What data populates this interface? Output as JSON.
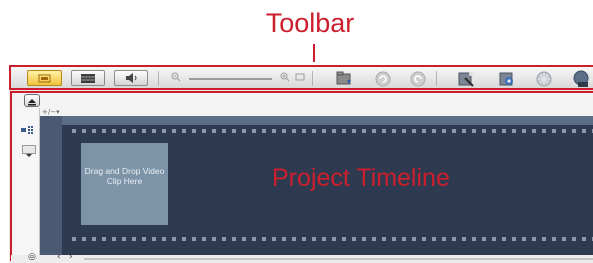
{
  "annotations": {
    "toolbar_label": "Toolbar",
    "timeline_label": "Project Timeline"
  },
  "toolbar": {
    "view_modes": [
      {
        "name": "storyboard-view",
        "active": true
      },
      {
        "name": "timeline-view",
        "active": false
      },
      {
        "name": "audio-view",
        "active": false
      }
    ],
    "tools": [
      "import-media-icon",
      "undo-icon",
      "redo-icon",
      "smart-fix-icon",
      "voice-over-icon",
      "music-icon",
      "share-icon"
    ]
  },
  "track": {
    "add_remove": "+/−▾"
  },
  "timeline": {
    "drop_hint": "Drag and Drop Video Clip Here"
  },
  "colors": {
    "annotation": "#cc1f2d",
    "timeline_bg": "#2d3a4f",
    "tile_bg": "#7d93a8",
    "active_button": "#f0c23a"
  }
}
